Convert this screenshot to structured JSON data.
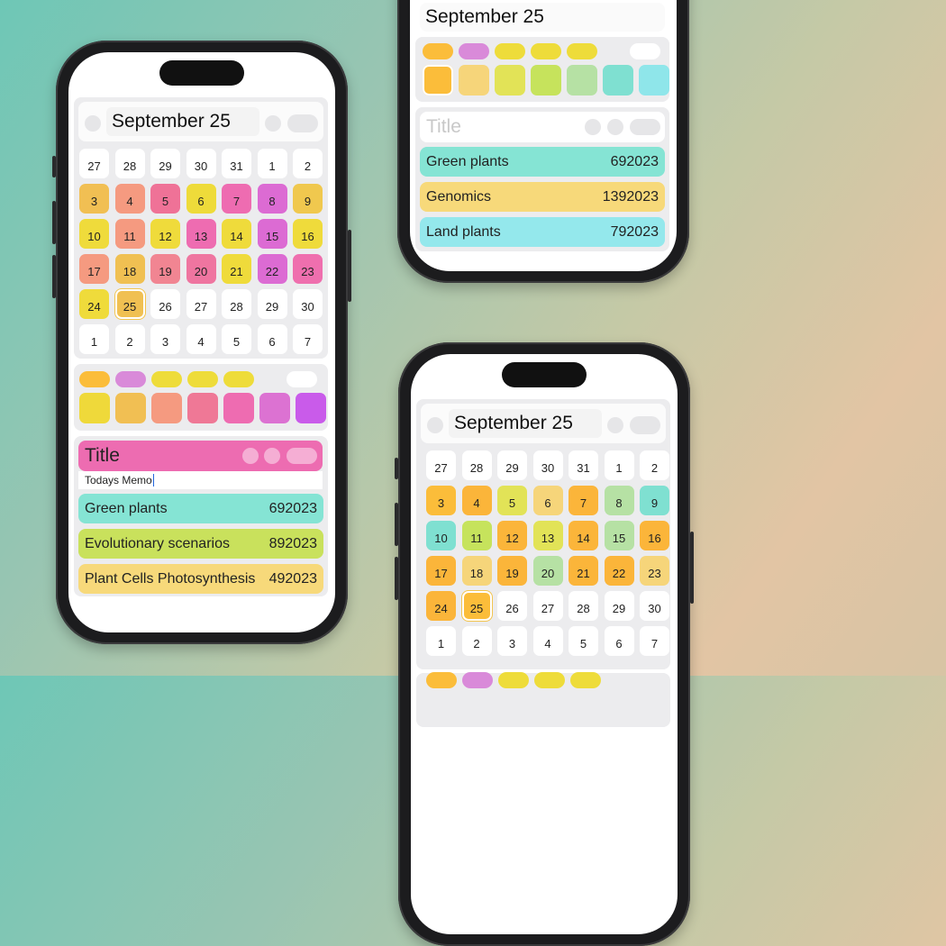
{
  "app": {
    "month_title": "September 25",
    "title_placeholder": "Title",
    "memo_placeholder": "Todays Memo"
  },
  "calendar_left": {
    "days": [
      {
        "n": "27",
        "c": "#ffffff"
      },
      {
        "n": "28",
        "c": "#ffffff"
      },
      {
        "n": "29",
        "c": "#ffffff"
      },
      {
        "n": "30",
        "c": "#ffffff"
      },
      {
        "n": "31",
        "c": "#ffffff"
      },
      {
        "n": "1",
        "c": "#ffffff"
      },
      {
        "n": "2",
        "c": "#ffffff"
      },
      {
        "n": "3",
        "c": "#f1bf53"
      },
      {
        "n": "4",
        "c": "#f59a80"
      },
      {
        "n": "5",
        "c": "#ef7297"
      },
      {
        "n": "6",
        "c": "#eedb3a"
      },
      {
        "n": "7",
        "c": "#ee6cb1"
      },
      {
        "n": "8",
        "c": "#dc6bd3"
      },
      {
        "n": "9",
        "c": "#f0c84e"
      },
      {
        "n": "10",
        "c": "#efdb3b"
      },
      {
        "n": "11",
        "c": "#f59a80"
      },
      {
        "n": "12",
        "c": "#efdb3b"
      },
      {
        "n": "13",
        "c": "#ee6cb1"
      },
      {
        "n": "14",
        "c": "#efdb3b"
      },
      {
        "n": "15",
        "c": "#dc6bd3"
      },
      {
        "n": "16",
        "c": "#efdb3b"
      },
      {
        "n": "17",
        "c": "#f59a80"
      },
      {
        "n": "18",
        "c": "#f0c052"
      },
      {
        "n": "19",
        "c": "#f18592"
      },
      {
        "n": "20",
        "c": "#ef75a0"
      },
      {
        "n": "21",
        "c": "#efdb3b"
      },
      {
        "n": "22",
        "c": "#dc6bd3"
      },
      {
        "n": "23",
        "c": "#ef6fae"
      },
      {
        "n": "24",
        "c": "#efdb3b"
      },
      {
        "n": "25",
        "c": "#f0c052",
        "sel": true
      },
      {
        "n": "26",
        "c": "#ffffff"
      },
      {
        "n": "27",
        "c": "#ffffff"
      },
      {
        "n": "28",
        "c": "#ffffff"
      },
      {
        "n": "29",
        "c": "#ffffff"
      },
      {
        "n": "30",
        "c": "#ffffff"
      },
      {
        "n": "1",
        "c": "#ffffff"
      },
      {
        "n": "2",
        "c": "#ffffff"
      },
      {
        "n": "3",
        "c": "#ffffff"
      },
      {
        "n": "4",
        "c": "#ffffff"
      },
      {
        "n": "5",
        "c": "#ffffff"
      },
      {
        "n": "6",
        "c": "#ffffff"
      },
      {
        "n": "7",
        "c": "#ffffff"
      }
    ],
    "swatch_top": [
      "#fbbd3a",
      "#d98ad9",
      "#eedc3a",
      "#eedc3a",
      "#eedc3a"
    ],
    "swatch_bottom": [
      "#efd93a",
      "#f1bf53",
      "#f59a80",
      "#ef7896",
      "#ee6cb1",
      "#dc72d2",
      "#c95bea"
    ],
    "memo_title_color": "#ed6cb1",
    "memos": [
      {
        "label": "Green plants",
        "value": "692023",
        "color": "#85e4d4"
      },
      {
        "label": "Evolutionary scenarios",
        "value": "892023",
        "color": "#c9e15c"
      },
      {
        "label": "Plant Cells Photosynthesis",
        "value": "492023",
        "color": "#f7d97a"
      }
    ]
  },
  "calendar_right": {
    "days": [
      {
        "n": "27",
        "c": "#ffffff"
      },
      {
        "n": "28",
        "c": "#ffffff"
      },
      {
        "n": "29",
        "c": "#ffffff"
      },
      {
        "n": "30",
        "c": "#ffffff"
      },
      {
        "n": "31",
        "c": "#ffffff"
      },
      {
        "n": "1",
        "c": "#ffffff"
      },
      {
        "n": "2",
        "c": "#ffffff"
      },
      {
        "n": "3",
        "c": "#fbbd3a"
      },
      {
        "n": "4",
        "c": "#fbb53a"
      },
      {
        "n": "5",
        "c": "#e2e357"
      },
      {
        "n": "6",
        "c": "#f6d57a"
      },
      {
        "n": "7",
        "c": "#fbb53a"
      },
      {
        "n": "8",
        "c": "#b6e1a4"
      },
      {
        "n": "9",
        "c": "#7fe0d1"
      },
      {
        "n": "10",
        "c": "#7fe0d1"
      },
      {
        "n": "11",
        "c": "#c6e35c"
      },
      {
        "n": "12",
        "c": "#fbb53a"
      },
      {
        "n": "13",
        "c": "#e2e357"
      },
      {
        "n": "14",
        "c": "#fbb53a"
      },
      {
        "n": "15",
        "c": "#b6e1a4"
      },
      {
        "n": "16",
        "c": "#fbb53a"
      },
      {
        "n": "17",
        "c": "#fbb53a"
      },
      {
        "n": "18",
        "c": "#f6d57a"
      },
      {
        "n": "19",
        "c": "#fbb53a"
      },
      {
        "n": "20",
        "c": "#b6e1a4"
      },
      {
        "n": "21",
        "c": "#fbb53a"
      },
      {
        "n": "22",
        "c": "#fbb53a"
      },
      {
        "n": "23",
        "c": "#f6d57a"
      },
      {
        "n": "24",
        "c": "#fbb53a"
      },
      {
        "n": "25",
        "c": "#fbbd3a",
        "sel": true
      },
      {
        "n": "26",
        "c": "#ffffff"
      },
      {
        "n": "27",
        "c": "#ffffff"
      },
      {
        "n": "28",
        "c": "#ffffff"
      },
      {
        "n": "29",
        "c": "#ffffff"
      },
      {
        "n": "30",
        "c": "#ffffff"
      },
      {
        "n": "1",
        "c": "#ffffff"
      },
      {
        "n": "2",
        "c": "#ffffff"
      },
      {
        "n": "3",
        "c": "#ffffff"
      },
      {
        "n": "4",
        "c": "#ffffff"
      },
      {
        "n": "5",
        "c": "#ffffff"
      },
      {
        "n": "6",
        "c": "#ffffff"
      },
      {
        "n": "7",
        "c": "#ffffff"
      }
    ]
  },
  "top_phone": {
    "swatch_top": [
      "#fbbd3a",
      "#d98ad9",
      "#eedc3a",
      "#eedc3a",
      "#eedc3a"
    ],
    "swatch_bottom": [
      "#fbbd3a",
      "#f6d57a",
      "#e2e357",
      "#c6e35c",
      "#b6e1a4",
      "#7fe0d1",
      "#8fe6ea"
    ],
    "memos": [
      {
        "label": "Green plants",
        "value": "692023",
        "color": "#85e4d4"
      },
      {
        "label": "Genomics",
        "value": "1392023",
        "color": "#f7d97a"
      },
      {
        "label": "Land plants",
        "value": "792023",
        "color": "#94e8ec"
      }
    ]
  }
}
